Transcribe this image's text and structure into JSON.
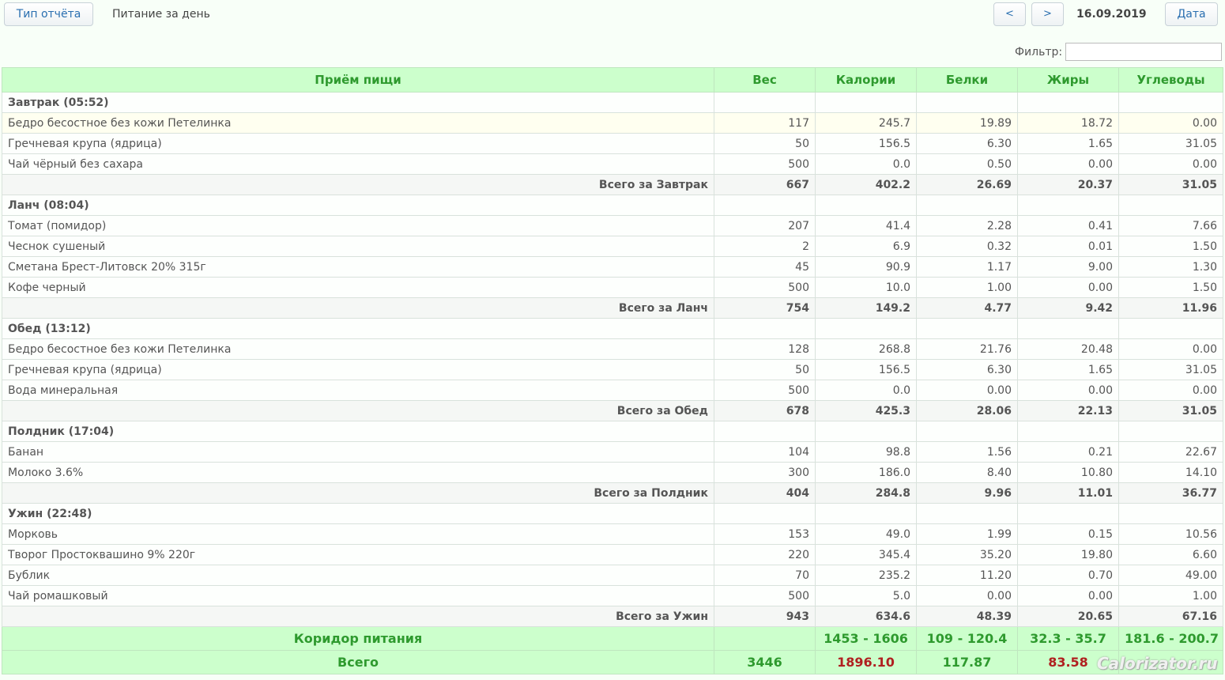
{
  "toolbar": {
    "report_type_label": "Тип отчёта",
    "title": "Питание за день",
    "prev_label": "<",
    "next_label": ">",
    "date": "16.09.2019",
    "date_button_label": "Дата"
  },
  "filter": {
    "label": "Фильтр:",
    "value": ""
  },
  "table": {
    "headers": [
      "Приём пищи",
      "Вес",
      "Калории",
      "Белки",
      "Жиры",
      "Углеводы"
    ],
    "meals": [
      {
        "title": "Завтрак (05:52)",
        "items": [
          {
            "name": "Бедро бесостное без кожи Петелинка",
            "weight": "117",
            "kcal": "245.7",
            "protein": "19.89",
            "fat": "18.72",
            "carbs": "0.00"
          },
          {
            "name": "Гречневая крупа (ядрица)",
            "weight": "50",
            "kcal": "156.5",
            "protein": "6.30",
            "fat": "1.65",
            "carbs": "31.05"
          },
          {
            "name": "Чай чёрный без сахара",
            "weight": "500",
            "kcal": "0.0",
            "protein": "0.50",
            "fat": "0.00",
            "carbs": "0.00"
          }
        ],
        "total": {
          "label": "Всего за Завтрак",
          "weight": "667",
          "kcal": "402.2",
          "protein": "26.69",
          "fat": "20.37",
          "carbs": "31.05"
        }
      },
      {
        "title": "Ланч (08:04)",
        "items": [
          {
            "name": "Томат (помидор)",
            "weight": "207",
            "kcal": "41.4",
            "protein": "2.28",
            "fat": "0.41",
            "carbs": "7.66"
          },
          {
            "name": "Чеснок сушеный",
            "weight": "2",
            "kcal": "6.9",
            "protein": "0.32",
            "fat": "0.01",
            "carbs": "1.50"
          },
          {
            "name": "Сметана Брест-Литовск 20% 315г",
            "weight": "45",
            "kcal": "90.9",
            "protein": "1.17",
            "fat": "9.00",
            "carbs": "1.30"
          },
          {
            "name": "Кофе черный",
            "weight": "500",
            "kcal": "10.0",
            "protein": "1.00",
            "fat": "0.00",
            "carbs": "1.50"
          }
        ],
        "total": {
          "label": "Всего за Ланч",
          "weight": "754",
          "kcal": "149.2",
          "protein": "4.77",
          "fat": "9.42",
          "carbs": "11.96"
        }
      },
      {
        "title": "Обед (13:12)",
        "items": [
          {
            "name": "Бедро бесостное без кожи Петелинка",
            "weight": "128",
            "kcal": "268.8",
            "protein": "21.76",
            "fat": "20.48",
            "carbs": "0.00"
          },
          {
            "name": "Гречневая крупа (ядрица)",
            "weight": "50",
            "kcal": "156.5",
            "protein": "6.30",
            "fat": "1.65",
            "carbs": "31.05"
          },
          {
            "name": "Вода минеральная",
            "weight": "500",
            "kcal": "0.0",
            "protein": "0.00",
            "fat": "0.00",
            "carbs": "0.00"
          }
        ],
        "total": {
          "label": "Всего за Обед",
          "weight": "678",
          "kcal": "425.3",
          "protein": "28.06",
          "fat": "22.13",
          "carbs": "31.05"
        }
      },
      {
        "title": "Полдник (17:04)",
        "items": [
          {
            "name": "Банан",
            "weight": "104",
            "kcal": "98.8",
            "protein": "1.56",
            "fat": "0.21",
            "carbs": "22.67"
          },
          {
            "name": "Молоко 3.6%",
            "weight": "300",
            "kcal": "186.0",
            "protein": "8.40",
            "fat": "10.80",
            "carbs": "14.10"
          }
        ],
        "total": {
          "label": "Всего за Полдник",
          "weight": "404",
          "kcal": "284.8",
          "protein": "9.96",
          "fat": "11.01",
          "carbs": "36.77"
        }
      },
      {
        "title": "Ужин (22:48)",
        "items": [
          {
            "name": "Морковь",
            "weight": "153",
            "kcal": "49.0",
            "protein": "1.99",
            "fat": "0.15",
            "carbs": "10.56"
          },
          {
            "name": "Творог Простоквашино 9% 220г",
            "weight": "220",
            "kcal": "345.4",
            "protein": "35.20",
            "fat": "19.80",
            "carbs": "6.60"
          },
          {
            "name": "Бублик",
            "weight": "70",
            "kcal": "235.2",
            "protein": "11.20",
            "fat": "0.70",
            "carbs": "49.00"
          },
          {
            "name": "Чай ромашковый",
            "weight": "500",
            "kcal": "5.0",
            "protein": "0.00",
            "fat": "0.00",
            "carbs": "1.00"
          }
        ],
        "total": {
          "label": "Всего за Ужин",
          "weight": "943",
          "kcal": "634.6",
          "protein": "48.39",
          "fat": "20.65",
          "carbs": "67.16"
        }
      }
    ],
    "corridor": {
      "label": "Коридор питания",
      "weight": "",
      "kcal": "1453 - 1606",
      "protein": "109 - 120.4",
      "fat": "32.3 - 35.7",
      "carbs": "181.6 - 200.7"
    },
    "grand_total": {
      "label": "Всего",
      "weight": "3446",
      "kcal": "1896.10",
      "protein": "117.87",
      "fat": "83.58",
      "carbs": ""
    }
  },
  "colors": {
    "header_bg": "#ccffcc",
    "header_text": "#2e9a2e",
    "over_limit": "#b02020",
    "link_blue": "#2a6fb0"
  },
  "watermark": "Calorizator.ru"
}
